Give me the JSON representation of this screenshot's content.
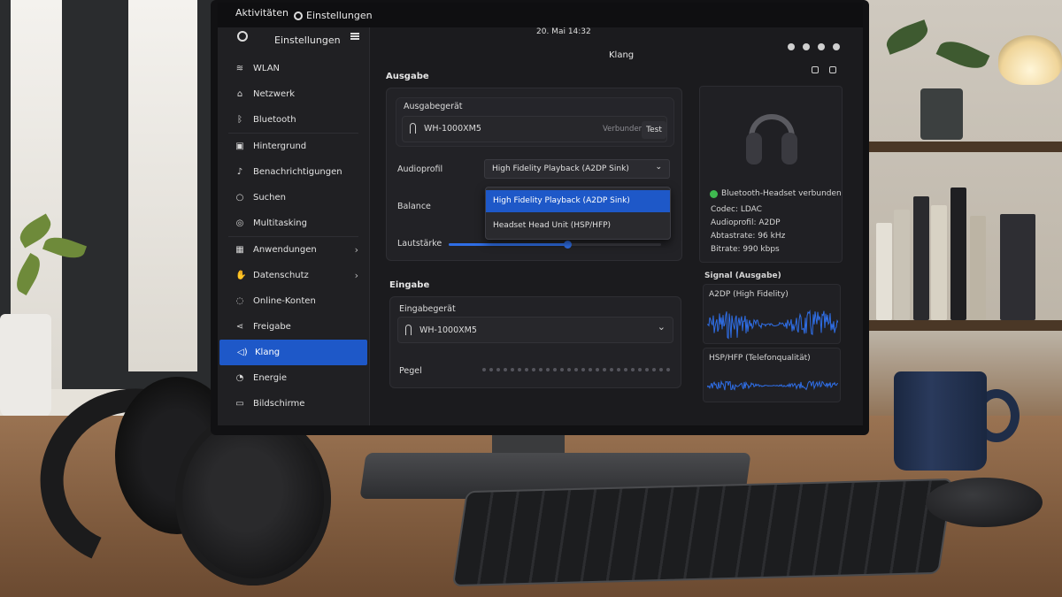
{
  "topbar": {
    "activities": "Aktivitäten",
    "app_name": "Einstellungen",
    "clock": "20. Mai 14:32"
  },
  "sidebar": {
    "title": "Einstellungen",
    "items": [
      {
        "label": "WLAN",
        "icon": "wifi-icon"
      },
      {
        "label": "Netzwerk",
        "icon": "network-icon"
      },
      {
        "label": "Bluetooth",
        "icon": "bluetooth-icon"
      },
      {
        "label": "Hintergrund",
        "icon": "background-icon"
      },
      {
        "label": "Benachrichtigungen",
        "icon": "bell-icon"
      },
      {
        "label": "Suchen",
        "icon": "search-icon"
      },
      {
        "label": "Multitasking",
        "icon": "multitasking-icon"
      },
      {
        "label": "Anwendungen",
        "icon": "apps-grid-icon"
      },
      {
        "label": "Datenschutz",
        "icon": "privacy-hand-icon"
      },
      {
        "label": "Online-Konten",
        "icon": "online-accounts-icon"
      },
      {
        "label": "Freigabe",
        "icon": "share-icon"
      },
      {
        "label": "Klang",
        "icon": "speaker-icon"
      },
      {
        "label": "Energie",
        "icon": "power-icon"
      },
      {
        "label": "Bildschirme",
        "icon": "display-icon"
      }
    ],
    "active": "Klang"
  },
  "content": {
    "title": "Klang",
    "output": {
      "section": "Ausgabe",
      "device_label": "Ausgabegerät",
      "device": "WH-1000XM5",
      "status": "Verbunden",
      "test_button": "Test",
      "profile_label": "Audioprofil",
      "profile_selected": "High Fidelity Playback (A2DP Sink)",
      "profile_options": [
        "High Fidelity Playback (A2DP Sink)",
        "Headset Head Unit (HSP/HFP)"
      ],
      "balance_label": "Balance",
      "volume_label": "Lautstärke",
      "volume": 0.56
    },
    "input": {
      "section": "Eingabe",
      "device_label": "Eingabegerät",
      "device": "WH-1000XM5",
      "level_label": "Pegel",
      "level": 0.0
    }
  },
  "side": {
    "status": "Bluetooth-Headset verbunden",
    "codec": "Codec: LDAC",
    "profile": "Audioprofil: A2DP",
    "samplerate": "Abtastrate: 96 kHz",
    "bitrate": "Bitrate: 990 kbps",
    "signal_title": "Signal (Ausgabe)",
    "wave1_label": "A2DP (High Fidelity)",
    "wave2_label": "HSP/HFP (Telefonqualität)",
    "colors": {
      "accent": "#1e58c8",
      "ok": "#3fb950",
      "wave": "#2f6ee6"
    }
  }
}
